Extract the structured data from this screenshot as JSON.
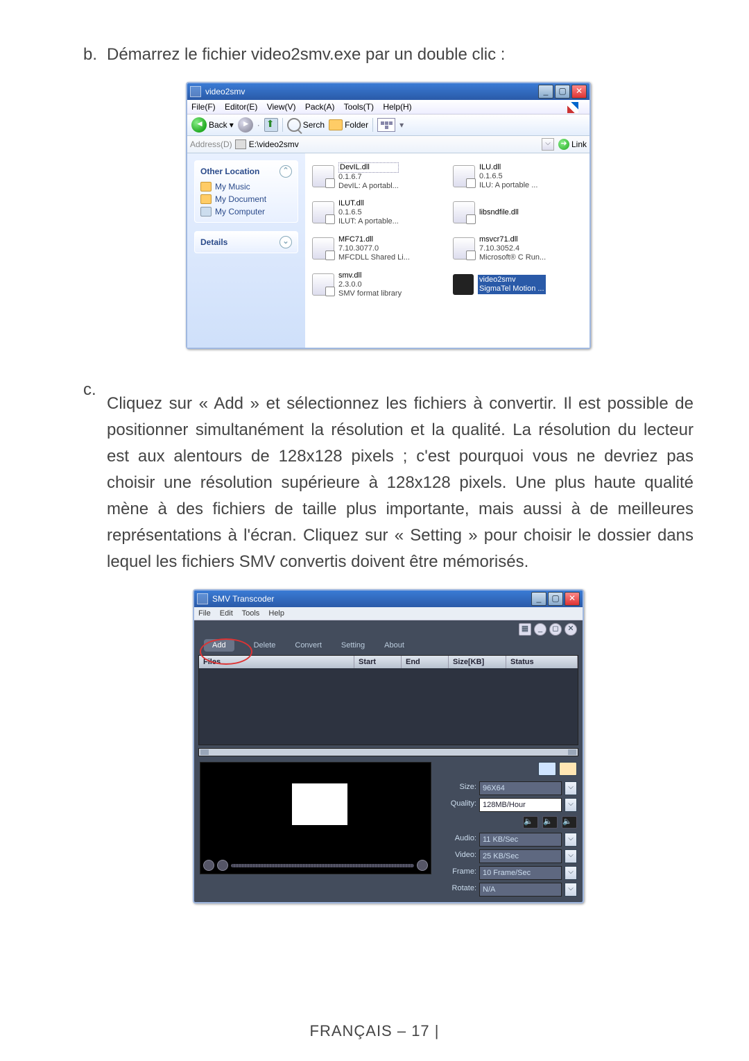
{
  "doc": {
    "item_b_label": "b.",
    "item_b_text": "Démarrez le fichier video2smv.exe par un double clic :",
    "item_c_label": "c.",
    "item_c_text": "Cliquez sur « Add » et sélectionnez les fichiers à convertir. Il est possible de positionner simultanément la résolution et la qualité. La résolution du lecteur est aux alentours de 128x128 pixels ; c'est pourquoi vous ne devriez pas choisir une résolution supérieure à 128x128 pixels. Une plus haute qualité mène à des fichiers de taille plus importante, mais aussi à de meilleures représentations à l'écran. Cliquez sur « Setting » pour choisir le dossier dans lequel les fichiers SMV convertis doivent être mémorisés.",
    "footer": "FRANÇAIS – 17  |"
  },
  "explorer": {
    "title": "video2smv",
    "menu": {
      "file": "File(F)",
      "editor": "Editor(E)",
      "view": "View(V)",
      "pack": "Pack(A)",
      "tools": "Tools(T)",
      "help": "Help(H)"
    },
    "toolbar": {
      "back": "Back",
      "search": "Serch",
      "folder": "Folder"
    },
    "address": {
      "label": "Address(D)",
      "path": "E:\\video2smv",
      "go": "Link"
    },
    "side": {
      "other_location": "Other Location",
      "items": [
        "My Music",
        "My Document",
        "My Computer"
      ],
      "details": "Details"
    },
    "files": [
      {
        "name": "DevIL.dll",
        "v": "0.1.6.7",
        "d": "DevIL: A portabl..."
      },
      {
        "name": "ILU.dll",
        "v": "0.1.6.5",
        "d": "ILU: A portable ..."
      },
      {
        "name": "ILUT.dll",
        "v": "0.1.6.5",
        "d": "ILUT: A portable..."
      },
      {
        "name": "libsndfile.dll",
        "v": "",
        "d": ""
      },
      {
        "name": "MFC71.dll",
        "v": "7.10.3077.0",
        "d": "MFCDLL Shared Li..."
      },
      {
        "name": "msvcr71.dll",
        "v": "7.10.3052.4",
        "d": "Microsoft® C Run..."
      },
      {
        "name": "smv.dll",
        "v": "2.3.0.0",
        "d": "SMV format library"
      },
      {
        "name": "video2smv",
        "v": "",
        "d": "SigmaTel Motion ..."
      }
    ]
  },
  "smv": {
    "title": "SMV Transcoder",
    "menu": {
      "file": "File",
      "edit": "Edit",
      "tools": "Tools",
      "help": "Help"
    },
    "tabs": {
      "add": "Add",
      "delete": "Delete",
      "convert": "Convert",
      "setting": "Setting",
      "about": "About"
    },
    "cols": {
      "files": "Files",
      "start": "Start",
      "end": "End",
      "size": "Size[KB]",
      "status": "Status"
    },
    "settings": {
      "size_label": "Size:",
      "size_value": "96X64",
      "quality_label": "Quality:",
      "quality_value": "128MB/Hour",
      "audio_label": "Audio:",
      "audio_value": "11 KB/Sec",
      "video_label": "Video:",
      "video_value": "25 KB/Sec",
      "frame_label": "Frame:",
      "frame_value": "10 Frame/Sec",
      "rotate_label": "Rotate:",
      "rotate_value": "N/A"
    }
  }
}
